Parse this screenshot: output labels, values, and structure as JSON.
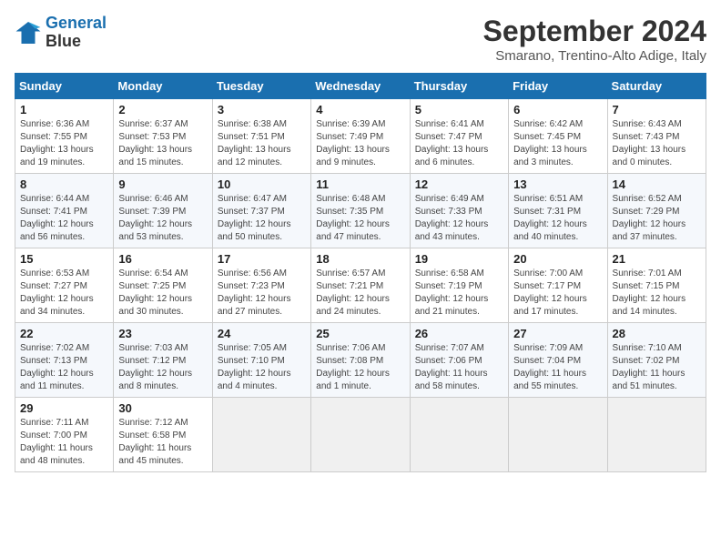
{
  "header": {
    "logo_line1": "General",
    "logo_line2": "Blue",
    "month": "September 2024",
    "location": "Smarano, Trentino-Alto Adige, Italy"
  },
  "days_of_week": [
    "Sunday",
    "Monday",
    "Tuesday",
    "Wednesday",
    "Thursday",
    "Friday",
    "Saturday"
  ],
  "weeks": [
    [
      {
        "day": "1",
        "info": "Sunrise: 6:36 AM\nSunset: 7:55 PM\nDaylight: 13 hours and 19 minutes."
      },
      {
        "day": "2",
        "info": "Sunrise: 6:37 AM\nSunset: 7:53 PM\nDaylight: 13 hours and 15 minutes."
      },
      {
        "day": "3",
        "info": "Sunrise: 6:38 AM\nSunset: 7:51 PM\nDaylight: 13 hours and 12 minutes."
      },
      {
        "day": "4",
        "info": "Sunrise: 6:39 AM\nSunset: 7:49 PM\nDaylight: 13 hours and 9 minutes."
      },
      {
        "day": "5",
        "info": "Sunrise: 6:41 AM\nSunset: 7:47 PM\nDaylight: 13 hours and 6 minutes."
      },
      {
        "day": "6",
        "info": "Sunrise: 6:42 AM\nSunset: 7:45 PM\nDaylight: 13 hours and 3 minutes."
      },
      {
        "day": "7",
        "info": "Sunrise: 6:43 AM\nSunset: 7:43 PM\nDaylight: 13 hours and 0 minutes."
      }
    ],
    [
      {
        "day": "8",
        "info": "Sunrise: 6:44 AM\nSunset: 7:41 PM\nDaylight: 12 hours and 56 minutes."
      },
      {
        "day": "9",
        "info": "Sunrise: 6:46 AM\nSunset: 7:39 PM\nDaylight: 12 hours and 53 minutes."
      },
      {
        "day": "10",
        "info": "Sunrise: 6:47 AM\nSunset: 7:37 PM\nDaylight: 12 hours and 50 minutes."
      },
      {
        "day": "11",
        "info": "Sunrise: 6:48 AM\nSunset: 7:35 PM\nDaylight: 12 hours and 47 minutes."
      },
      {
        "day": "12",
        "info": "Sunrise: 6:49 AM\nSunset: 7:33 PM\nDaylight: 12 hours and 43 minutes."
      },
      {
        "day": "13",
        "info": "Sunrise: 6:51 AM\nSunset: 7:31 PM\nDaylight: 12 hours and 40 minutes."
      },
      {
        "day": "14",
        "info": "Sunrise: 6:52 AM\nSunset: 7:29 PM\nDaylight: 12 hours and 37 minutes."
      }
    ],
    [
      {
        "day": "15",
        "info": "Sunrise: 6:53 AM\nSunset: 7:27 PM\nDaylight: 12 hours and 34 minutes."
      },
      {
        "day": "16",
        "info": "Sunrise: 6:54 AM\nSunset: 7:25 PM\nDaylight: 12 hours and 30 minutes."
      },
      {
        "day": "17",
        "info": "Sunrise: 6:56 AM\nSunset: 7:23 PM\nDaylight: 12 hours and 27 minutes."
      },
      {
        "day": "18",
        "info": "Sunrise: 6:57 AM\nSunset: 7:21 PM\nDaylight: 12 hours and 24 minutes."
      },
      {
        "day": "19",
        "info": "Sunrise: 6:58 AM\nSunset: 7:19 PM\nDaylight: 12 hours and 21 minutes."
      },
      {
        "day": "20",
        "info": "Sunrise: 7:00 AM\nSunset: 7:17 PM\nDaylight: 12 hours and 17 minutes."
      },
      {
        "day": "21",
        "info": "Sunrise: 7:01 AM\nSunset: 7:15 PM\nDaylight: 12 hours and 14 minutes."
      }
    ],
    [
      {
        "day": "22",
        "info": "Sunrise: 7:02 AM\nSunset: 7:13 PM\nDaylight: 12 hours and 11 minutes."
      },
      {
        "day": "23",
        "info": "Sunrise: 7:03 AM\nSunset: 7:12 PM\nDaylight: 12 hours and 8 minutes."
      },
      {
        "day": "24",
        "info": "Sunrise: 7:05 AM\nSunset: 7:10 PM\nDaylight: 12 hours and 4 minutes."
      },
      {
        "day": "25",
        "info": "Sunrise: 7:06 AM\nSunset: 7:08 PM\nDaylight: 12 hours and 1 minute."
      },
      {
        "day": "26",
        "info": "Sunrise: 7:07 AM\nSunset: 7:06 PM\nDaylight: 11 hours and 58 minutes."
      },
      {
        "day": "27",
        "info": "Sunrise: 7:09 AM\nSunset: 7:04 PM\nDaylight: 11 hours and 55 minutes."
      },
      {
        "day": "28",
        "info": "Sunrise: 7:10 AM\nSunset: 7:02 PM\nDaylight: 11 hours and 51 minutes."
      }
    ],
    [
      {
        "day": "29",
        "info": "Sunrise: 7:11 AM\nSunset: 7:00 PM\nDaylight: 11 hours and 48 minutes."
      },
      {
        "day": "30",
        "info": "Sunrise: 7:12 AM\nSunset: 6:58 PM\nDaylight: 11 hours and 45 minutes."
      },
      {
        "day": "",
        "info": ""
      },
      {
        "day": "",
        "info": ""
      },
      {
        "day": "",
        "info": ""
      },
      {
        "day": "",
        "info": ""
      },
      {
        "day": "",
        "info": ""
      }
    ]
  ]
}
